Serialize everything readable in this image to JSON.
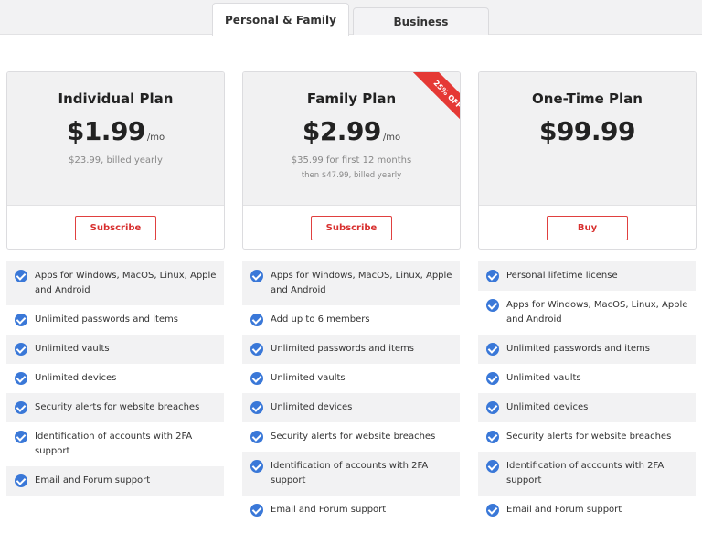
{
  "tabs": [
    {
      "label": "Personal & Family",
      "active": true
    },
    {
      "label": "Business",
      "active": false
    }
  ],
  "plans": [
    {
      "name": "Individual Plan",
      "price": "$1.99",
      "period": "/mo",
      "note": "$23.99, billed yearly",
      "note2": "",
      "button": "Subscribe",
      "features": [
        "Apps for Windows, MacOS, Linux, Apple and Android",
        "Unlimited passwords and items",
        "Unlimited vaults",
        "Unlimited devices",
        "Security alerts for website breaches",
        "Identification of accounts with 2FA support",
        "Email and Forum support"
      ]
    },
    {
      "name": "Family Plan",
      "price": "$2.99",
      "period": "/mo",
      "note": "$35.99 for first 12 months",
      "note2": "then $47.99, billed yearly",
      "button": "Subscribe",
      "ribbon": "25% OFF",
      "features": [
        "Apps for Windows, MacOS, Linux, Apple and Android",
        "Add up to 6 members",
        "Unlimited passwords and items",
        "Unlimited vaults",
        "Unlimited devices",
        "Security alerts for website breaches",
        "Identification of accounts with 2FA support",
        "Email and Forum support"
      ]
    },
    {
      "name": "One-Time Plan",
      "price": "$99.99",
      "period": "",
      "note": "",
      "note2": "",
      "button": "Buy",
      "features": [
        "Personal lifetime license",
        "Apps for Windows, MacOS, Linux, Apple and Android",
        "Unlimited passwords and items",
        "Unlimited vaults",
        "Unlimited devices",
        "Security alerts for website breaches",
        "Identification of accounts with 2FA support",
        "Email and Forum support"
      ]
    }
  ],
  "colors": {
    "accent_red": "#e53935",
    "check_blue": "#3a78d8"
  }
}
